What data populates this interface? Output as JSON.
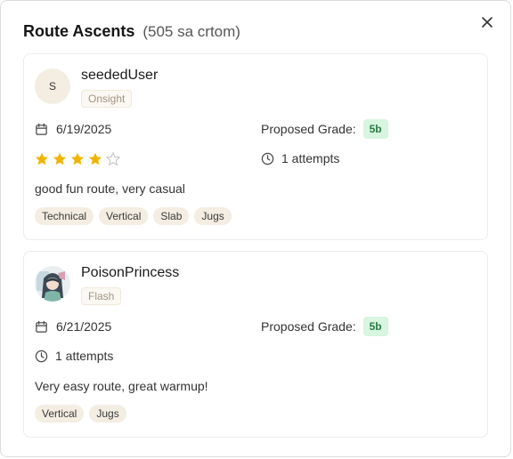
{
  "modal": {
    "title": "Route Ascents",
    "subtitle": "(505 sa crtom)",
    "close_icon": "close-icon"
  },
  "ascents": [
    {
      "avatar_initial": "S",
      "username": "seededUser",
      "style": "Onsight",
      "date": "6/19/2025",
      "proposed_grade_label": "Proposed Grade:",
      "grade": "5b",
      "rating": 4,
      "rating_max": 5,
      "attempts": "1 attempts",
      "comment": "good fun route, very casual",
      "tags": [
        "Technical",
        "Vertical",
        "Slab",
        "Jugs"
      ]
    },
    {
      "avatar_initial": "",
      "username": "PoisonPrincess",
      "style": "Flash",
      "date": "6/21/2025",
      "proposed_grade_label": "Proposed Grade:",
      "grade": "5b",
      "attempts": "1 attempts",
      "comment": "Very easy route, great warmup!",
      "tags": [
        "Vertical",
        "Jugs"
      ]
    }
  ],
  "colors": {
    "star_filled": "#f0b400",
    "grade_bg": "#d7f5df",
    "grade_text": "#2b7a46",
    "tag_bg": "#f3ede2"
  }
}
